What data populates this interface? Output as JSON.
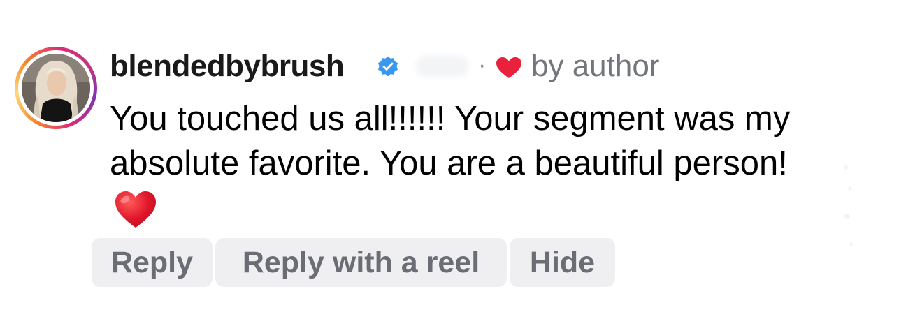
{
  "comment": {
    "username": "blendedbybrush",
    "verified": true,
    "separator": "·",
    "liked_by_author_label": "by author",
    "text": "You touched us all!!!!!! Your segment was my absolute favorite. You are a beautiful person!",
    "emoji": "red-heart"
  },
  "actions": {
    "reply": "Reply",
    "reply_with_reel": "Reply with a reel",
    "hide": "Hide"
  },
  "colors": {
    "verified_badge": "#3897f0",
    "heart": "#e8223d",
    "chip_background": "#efeff1",
    "chip_text": "#6a6d73",
    "secondary_text": "#73767c"
  },
  "icons": {
    "verified": "verified-badge-icon",
    "liked": "heart-icon",
    "emoji": "red-heart-emoji"
  }
}
